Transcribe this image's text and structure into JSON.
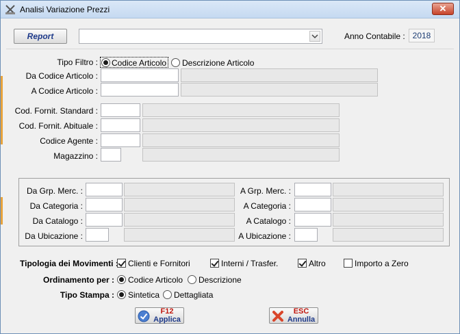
{
  "window": {
    "title": "Analisi Variazione Prezzi",
    "close_label": "✕"
  },
  "toolbar": {
    "report_label": "Report",
    "combo_value": ""
  },
  "anno": {
    "label": "Anno Contabile :",
    "value": "2018"
  },
  "tipo_filtro": {
    "label": "Tipo Filtro :",
    "options": [
      "Codice Articolo",
      "Descrizione Articolo"
    ],
    "selected": "Codice Articolo"
  },
  "fields": {
    "da_codice_articolo": "Da Codice Articolo :",
    "a_codice_articolo": "A Codice Articolo :",
    "cod_fornit_standard": "Cod. Fornit. Standard :",
    "cod_fornit_abituale": "Cod. Fornit. Abituale :",
    "codice_agente": "Codice Agente :",
    "magazzino": "Magazzino :"
  },
  "group": {
    "da_grp_merc": "Da Grp. Merc. :",
    "a_grp_merc": "A Grp. Merc. :",
    "da_categoria": "Da Categoria :",
    "a_categoria": "A  Categoria :",
    "da_catalogo": "Da Catalogo :",
    "a_catalogo": "A Catalogo :",
    "da_ubicazione": "Da Ubicazione :",
    "a_ubicazione": "A Ubicazione :"
  },
  "movimenti": {
    "label": "Tipologia dei Movimenti :",
    "options": [
      {
        "label": "Clienti e Fornitori",
        "checked": true
      },
      {
        "label": "Interni / Trasfer.",
        "checked": true
      },
      {
        "label": "Altro",
        "checked": true
      },
      {
        "label": "Importo a Zero",
        "checked": false
      }
    ]
  },
  "ordinamento": {
    "label": "Ordinamento per :",
    "options": [
      "Codice Articolo",
      "Descrizione"
    ],
    "selected": "Codice Articolo"
  },
  "stampa": {
    "label": "Tipo Stampa :",
    "options": [
      "Sintetica",
      "Dettagliata"
    ],
    "selected": "Sintetica"
  },
  "buttons": {
    "applica": {
      "key": "F12",
      "label": "Applica",
      "icon": "check-icon"
    },
    "annulla": {
      "key": "ESC",
      "label": "Annulla",
      "icon": "x-icon"
    }
  },
  "colors": {
    "accent": "#1e3a8a",
    "key": "#c0180f",
    "side_marker": "#e8a33c"
  }
}
